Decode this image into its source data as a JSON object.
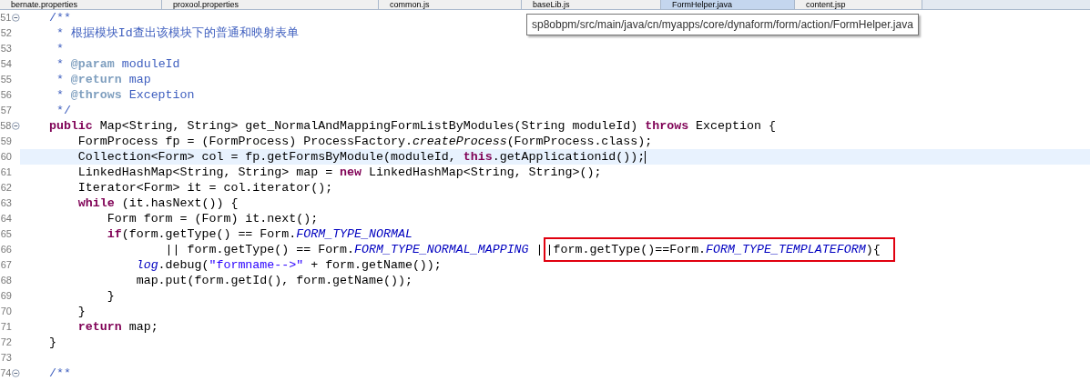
{
  "tabs": [
    {
      "label": "bernate.properties",
      "selected": false
    },
    {
      "label": "proxool.properties",
      "selected": false
    },
    {
      "label": "common.js",
      "selected": false
    },
    {
      "label": "baseLib.js",
      "selected": false
    },
    {
      "label": "FormHelper.java",
      "selected": true
    },
    {
      "label": "content.jsp",
      "selected": false
    }
  ],
  "tooltip": "sp8obpm/src/main/java/cn/myapps/core/dynaform/form/action/FormHelper.java",
  "lines": [
    {
      "number": "51",
      "fold": true,
      "current": false,
      "tokens": [
        {
          "kind": "doc",
          "text": "    /**"
        }
      ]
    },
    {
      "number": "52",
      "fold": false,
      "current": false,
      "tokens": [
        {
          "kind": "doc",
          "text": "     * 根据模块Id查出该模块下的普通和映射表单"
        }
      ]
    },
    {
      "number": "53",
      "fold": false,
      "current": false,
      "tokens": [
        {
          "kind": "doc",
          "text": "     *"
        }
      ]
    },
    {
      "number": "54",
      "fold": false,
      "current": false,
      "tokens": [
        {
          "kind": "doc",
          "text": "     * "
        },
        {
          "kind": "tag",
          "text": "@param"
        },
        {
          "kind": "doc",
          "text": " moduleId"
        }
      ]
    },
    {
      "number": "55",
      "fold": false,
      "current": false,
      "tokens": [
        {
          "kind": "doc",
          "text": "     * "
        },
        {
          "kind": "tag",
          "text": "@return"
        },
        {
          "kind": "doc",
          "text": " map"
        }
      ]
    },
    {
      "number": "56",
      "fold": false,
      "current": false,
      "tokens": [
        {
          "kind": "doc",
          "text": "     * "
        },
        {
          "kind": "tag",
          "text": "@throws"
        },
        {
          "kind": "doc",
          "text": " Exception"
        }
      ]
    },
    {
      "number": "57",
      "fold": false,
      "current": false,
      "tokens": [
        {
          "kind": "doc",
          "text": "     */"
        }
      ]
    },
    {
      "number": "58",
      "fold": true,
      "current": false,
      "tokens": [
        {
          "kind": "keyword",
          "text": "    public"
        },
        {
          "kind": "plain",
          "text": " Map<String, String> get_NormalAndMappingFormListByModules(String moduleId) "
        },
        {
          "kind": "keyword",
          "text": "throws"
        },
        {
          "kind": "plain",
          "text": " Exception {"
        }
      ]
    },
    {
      "number": "59",
      "fold": false,
      "current": false,
      "tokens": [
        {
          "kind": "plain",
          "text": "        FormProcess fp = (FormProcess) ProcessFactory."
        },
        {
          "kind": "italic",
          "text": "createProcess"
        },
        {
          "kind": "plain",
          "text": "(FormProcess.class);"
        }
      ]
    },
    {
      "number": "60",
      "fold": false,
      "current": true,
      "tokens": [
        {
          "kind": "plain",
          "text": "        Collection<Form> col = fp.getFormsByModule(moduleId, "
        },
        {
          "kind": "keyword",
          "text": "this"
        },
        {
          "kind": "plain",
          "text": ".getApplicationid());"
        }
      ]
    },
    {
      "number": "61",
      "fold": false,
      "current": false,
      "tokens": [
        {
          "kind": "plain",
          "text": "        LinkedHashMap<String, String> map = "
        },
        {
          "kind": "keyword",
          "text": "new"
        },
        {
          "kind": "plain",
          "text": " LinkedHashMap<String, String>();"
        }
      ]
    },
    {
      "number": "62",
      "fold": false,
      "current": false,
      "tokens": [
        {
          "kind": "plain",
          "text": "        Iterator<Form> it = col.iterator();"
        }
      ]
    },
    {
      "number": "63",
      "fold": false,
      "current": false,
      "tokens": [
        {
          "kind": "keyword",
          "text": "        while"
        },
        {
          "kind": "plain",
          "text": " (it.hasNext()) {"
        }
      ]
    },
    {
      "number": "64",
      "fold": false,
      "current": false,
      "tokens": [
        {
          "kind": "plain",
          "text": "            Form form = (Form) it.next();"
        }
      ]
    },
    {
      "number": "65",
      "fold": false,
      "current": false,
      "tokens": [
        {
          "kind": "keyword",
          "text": "            if"
        },
        {
          "kind": "plain",
          "text": "(form.getType() == Form."
        },
        {
          "kind": "static",
          "text": "FORM_TYPE_NORMAL"
        }
      ]
    },
    {
      "number": "66",
      "fold": false,
      "current": false,
      "tokens": [
        {
          "kind": "plain",
          "text": "                    || form.getType() == Form."
        },
        {
          "kind": "static",
          "text": "FORM_TYPE_NORMAL_MAPPING"
        },
        {
          "kind": "plain",
          "text": " |"
        }
      ],
      "boxed_tokens": [
        {
          "kind": "plain",
          "text": "|form.getType()==Form."
        },
        {
          "kind": "static",
          "text": "FORM_TYPE_TEMPLATEFORM"
        },
        {
          "kind": "plain",
          "text": "){"
        }
      ]
    },
    {
      "number": "67",
      "fold": false,
      "current": false,
      "tokens": [
        {
          "kind": "static",
          "text": "                log"
        },
        {
          "kind": "plain",
          "text": ".debug("
        },
        {
          "kind": "string",
          "text": "\"formname-->\""
        },
        {
          "kind": "plain",
          "text": " + form.getName());"
        }
      ]
    },
    {
      "number": "68",
      "fold": false,
      "current": false,
      "tokens": [
        {
          "kind": "plain",
          "text": "                map.put(form.getId(), form.getName());"
        }
      ]
    },
    {
      "number": "69",
      "fold": false,
      "current": false,
      "tokens": [
        {
          "kind": "plain",
          "text": "            }"
        }
      ]
    },
    {
      "number": "70",
      "fold": false,
      "current": false,
      "tokens": [
        {
          "kind": "plain",
          "text": "        }"
        }
      ]
    },
    {
      "number": "71",
      "fold": false,
      "current": false,
      "tokens": [
        {
          "kind": "keyword",
          "text": "        return"
        },
        {
          "kind": "plain",
          "text": " map;"
        }
      ]
    },
    {
      "number": "72",
      "fold": false,
      "current": false,
      "tokens": [
        {
          "kind": "plain",
          "text": "    }"
        }
      ]
    },
    {
      "number": "73",
      "fold": false,
      "current": false
    },
    {
      "number": "74",
      "fold": true,
      "current": false,
      "tokens": [
        {
          "kind": "doc",
          "text": "    /**"
        }
      ]
    }
  ]
}
